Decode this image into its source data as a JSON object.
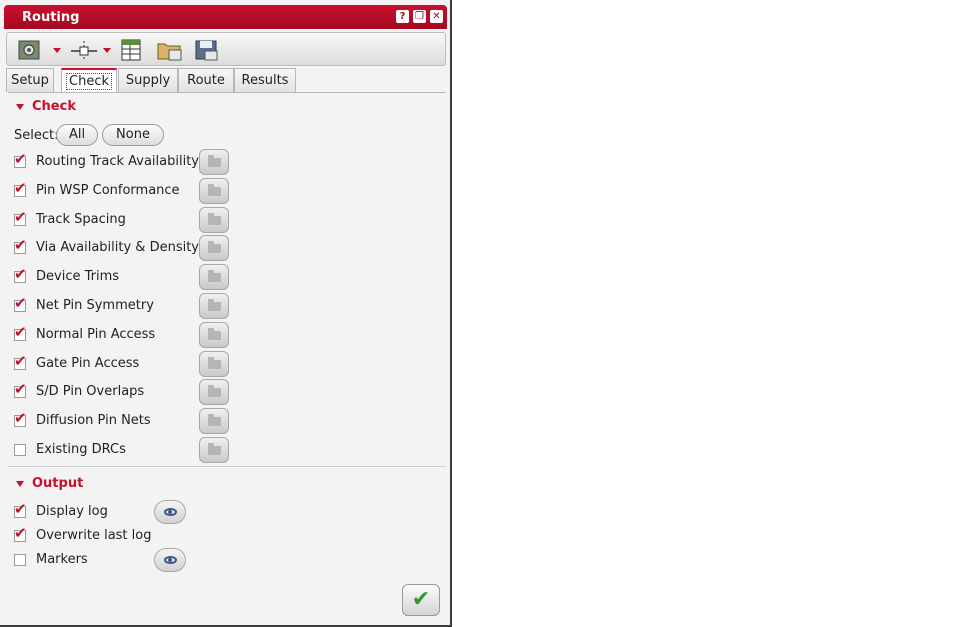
{
  "window": {
    "title": "Routing",
    "controls": [
      "?",
      "❐",
      "✕"
    ]
  },
  "toolbar": {
    "tools": [
      "route-config-icon",
      "connection-icon",
      "table-icon",
      "folder-open-icon",
      "save-icon"
    ]
  },
  "tabs": [
    {
      "label": "Setup",
      "active": false
    },
    {
      "label": "Check",
      "active": true
    },
    {
      "label": "Supply",
      "active": false
    },
    {
      "label": "Route",
      "active": false
    },
    {
      "label": "Results",
      "active": false
    }
  ],
  "check_section": {
    "title": "Check",
    "select_label": "Select:",
    "all_label": "All",
    "none_label": "None",
    "items": [
      {
        "label": "Routing Track Availability",
        "checked": true
      },
      {
        "label": "Pin WSP Conformance",
        "checked": true
      },
      {
        "label": "Track Spacing",
        "checked": true
      },
      {
        "label": "Via Availability & Density",
        "checked": true
      },
      {
        "label": "Device Trims",
        "checked": true
      },
      {
        "label": "Net Pin Symmetry",
        "checked": true
      },
      {
        "label": "Normal Pin Access",
        "checked": true
      },
      {
        "label": "Gate Pin Access",
        "checked": true
      },
      {
        "label": "S/D Pin Overlaps",
        "checked": true
      },
      {
        "label": "Diffusion Pin Nets",
        "checked": true
      },
      {
        "label": "Existing DRCs",
        "checked": false
      }
    ]
  },
  "output_section": {
    "title": "Output",
    "items": [
      {
        "label": "Display log",
        "checked": true,
        "has_view": true
      },
      {
        "label": "Overwrite last log",
        "checked": true,
        "has_view": false
      },
      {
        "label": "Markers",
        "checked": false,
        "has_view": true
      }
    ]
  },
  "ok_button": {
    "symbol": "✔"
  },
  "colors": {
    "accent": "#c8102e",
    "ok_green": "#2e9a2e"
  }
}
